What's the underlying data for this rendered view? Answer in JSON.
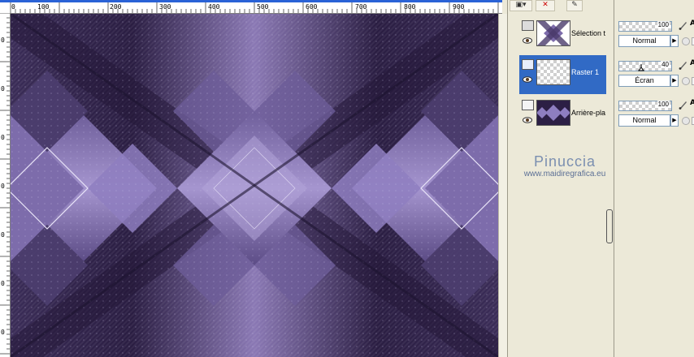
{
  "ruler": {
    "top_labels": [
      "0",
      "100",
      "200",
      "300",
      "400",
      "500",
      "600",
      "700",
      "800",
      "900"
    ],
    "left_labels": [
      "0",
      "0",
      "0",
      "0",
      "0",
      "0",
      "0",
      "0",
      "0"
    ],
    "accent": "#2a62d6"
  },
  "canvas": {
    "palette": {
      "dark": "#2c1f45",
      "mid": "#53436f",
      "light": "#9d8cc6",
      "highlight": "#e9e4f8"
    }
  },
  "layers_toolbar": {
    "icons": [
      "layer-new-icon",
      "delete-layer-icon",
      "layer-properties-icon"
    ]
  },
  "layers": [
    {
      "name": "Sélection t",
      "selected": false,
      "thumb": "pattern"
    },
    {
      "name": "Raster 1",
      "selected": true,
      "thumb": "transparent"
    },
    {
      "name": "Arrière-pla",
      "selected": false,
      "thumb": "pattern"
    }
  ],
  "layer_props": [
    {
      "opacity": "100",
      "blend": "Normal",
      "cut_label": "A"
    },
    {
      "opacity": "40",
      "blend": "Écran",
      "cut_label": "A"
    },
    {
      "opacity": "100",
      "blend": "Normal",
      "cut_label": "A"
    }
  ],
  "watermark": {
    "name": "Pinuccia",
    "url": "www.maidiregrafica.eu"
  },
  "colors": {
    "selection": "#316ac5",
    "panel": "#ece9d8"
  }
}
